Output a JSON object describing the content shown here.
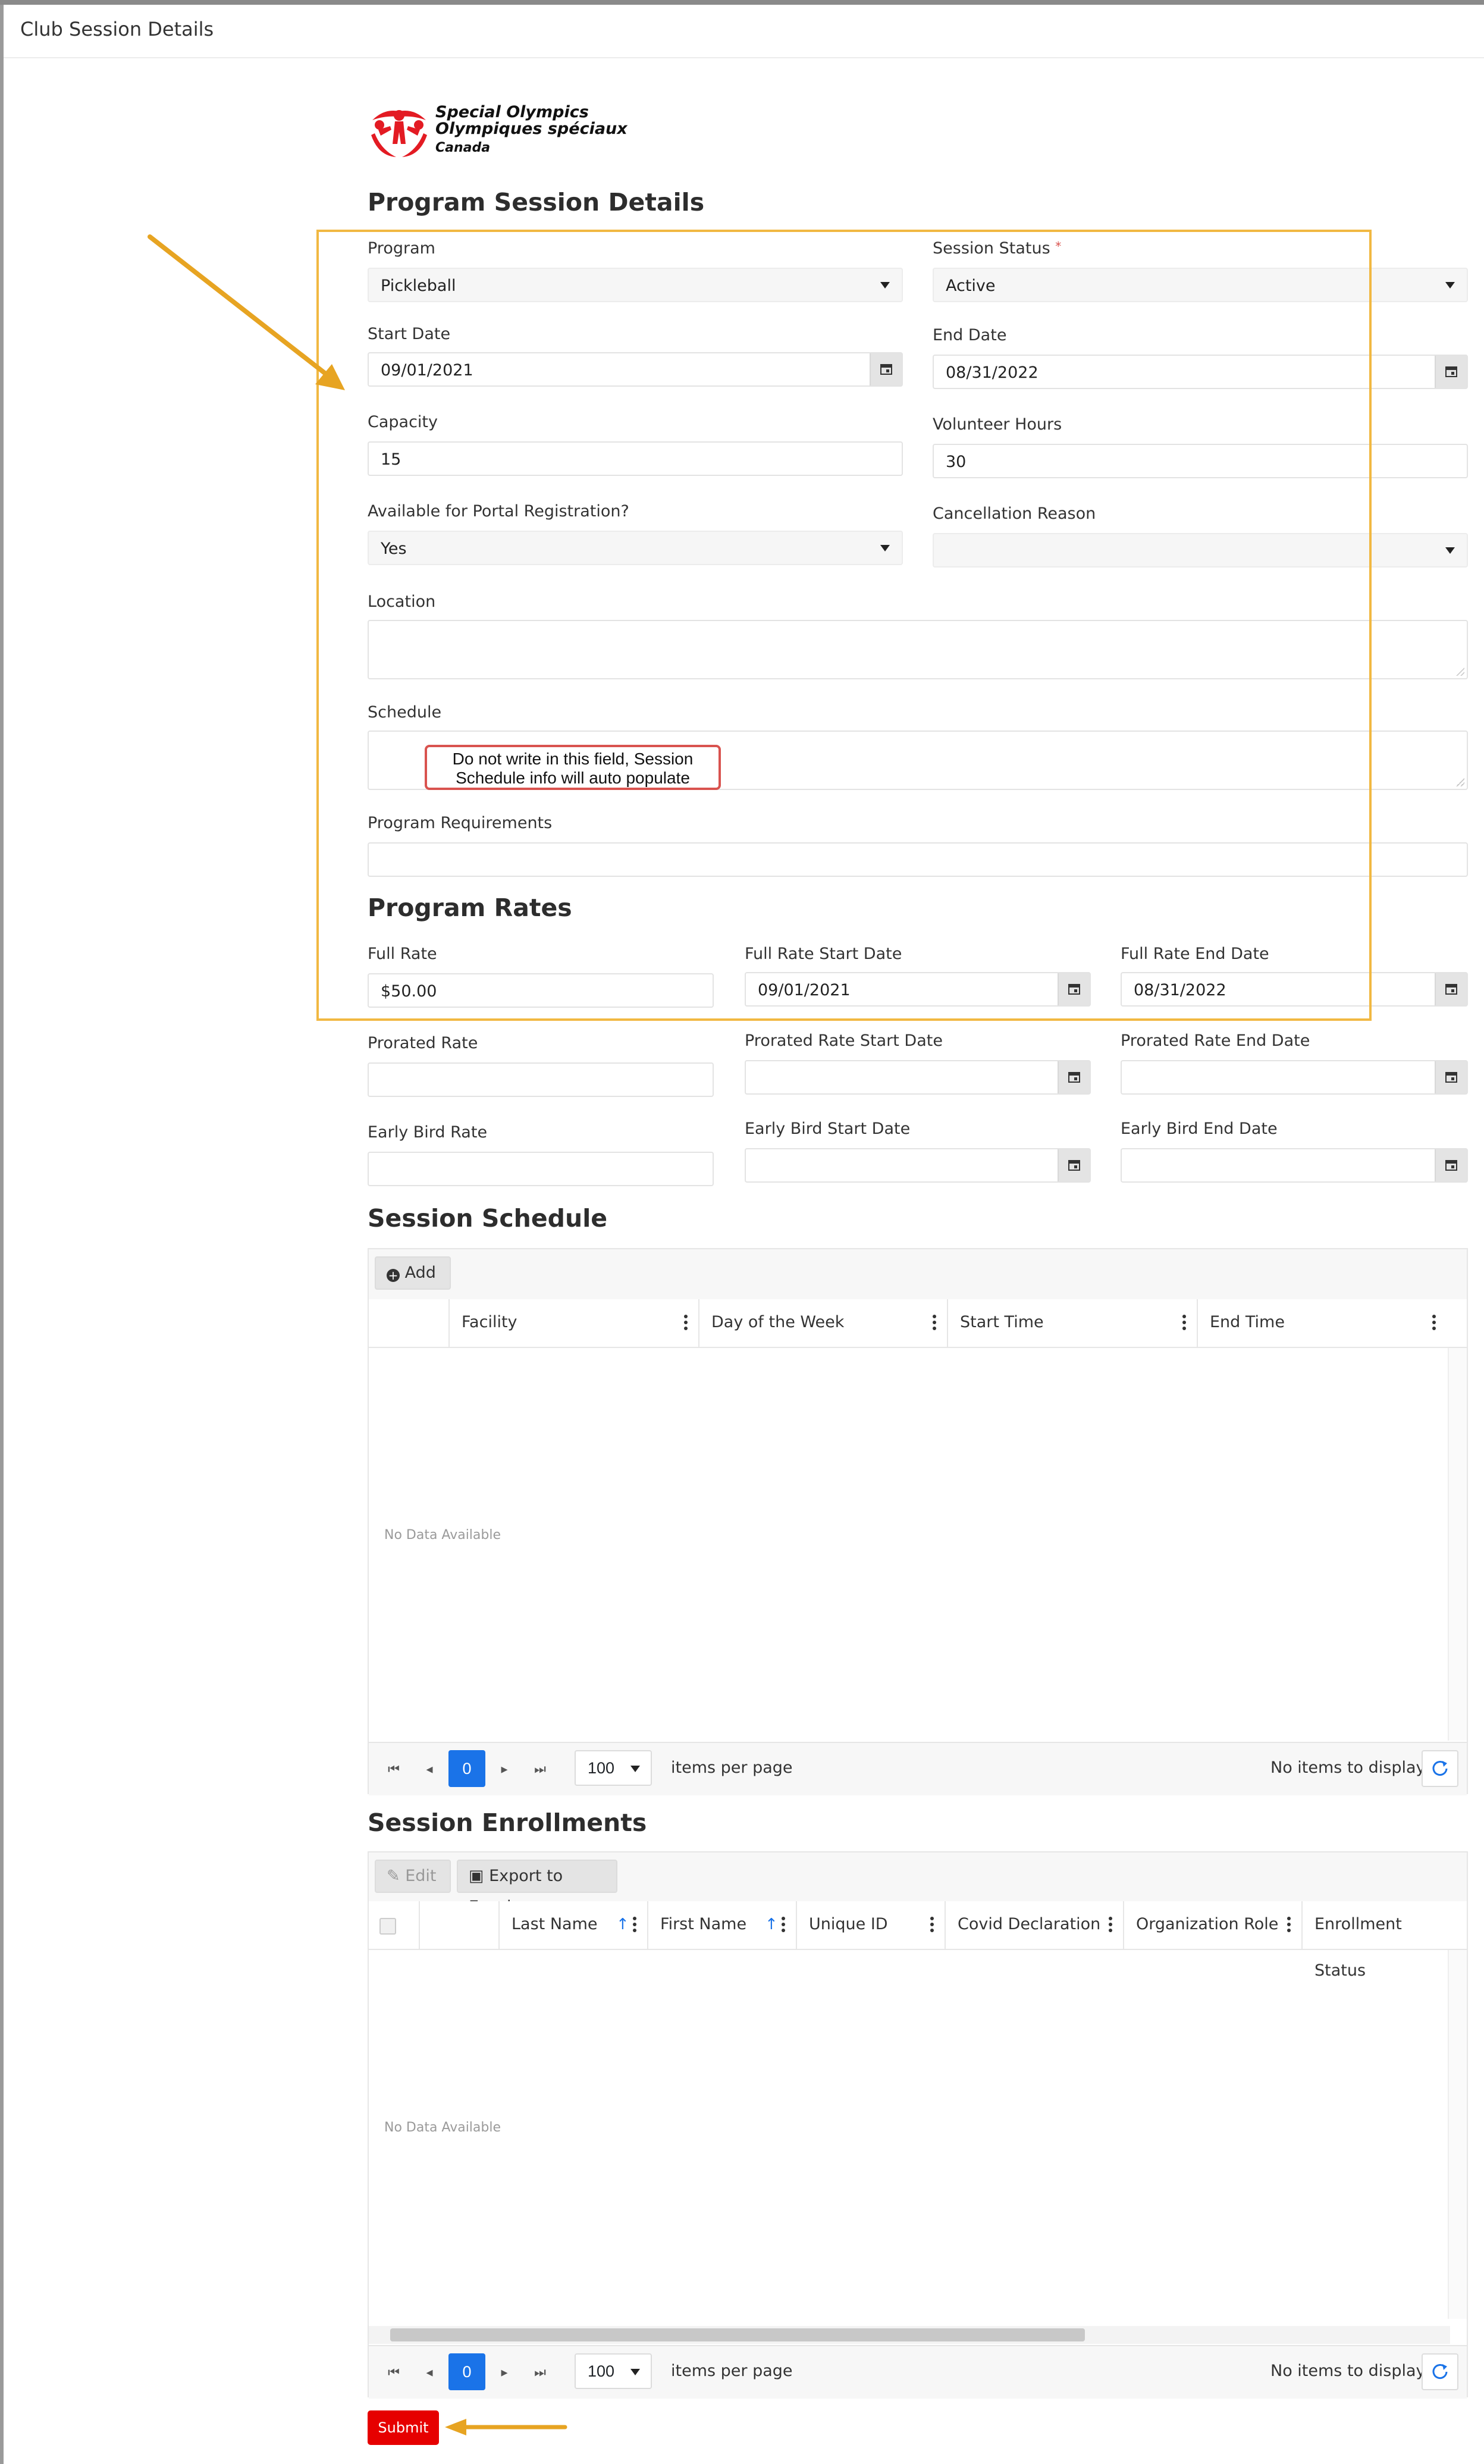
{
  "window": {
    "title": "Club Session Details"
  },
  "logo": {
    "line1": "Special Olympics",
    "line2": "Olympiques spéciaux",
    "line3": "Canada"
  },
  "colors": {
    "accent": "#1a73e8",
    "highlight": "#f1b842",
    "submit": "#e60000",
    "callout_border": "#d9534f"
  },
  "details": {
    "heading": "Program Session Details",
    "program": {
      "label": "Program",
      "value": "Pickleball"
    },
    "session_status": {
      "label": "Session Status",
      "required_mark": "*",
      "value": "Active"
    },
    "start_date": {
      "label": "Start Date",
      "value": "09/01/2021"
    },
    "end_date": {
      "label": "End Date",
      "value": "08/31/2022"
    },
    "capacity": {
      "label": "Capacity",
      "value": "15"
    },
    "volunteer_hours": {
      "label": "Volunteer Hours",
      "value": "30"
    },
    "portal_registration": {
      "label": "Available for Portal Registration?",
      "value": "Yes"
    },
    "cancellation_reason": {
      "label": "Cancellation Reason",
      "value": ""
    },
    "location": {
      "label": "Location",
      "value": ""
    },
    "schedule": {
      "label": "Schedule",
      "value": ""
    },
    "program_requirements": {
      "label": "Program Requirements",
      "value": ""
    },
    "callout": "Do not write in this field, Session Schedule info will auto populate"
  },
  "rates": {
    "heading": "Program Rates",
    "full_rate": {
      "label": "Full Rate",
      "value": "$50.00"
    },
    "full_rate_start": {
      "label": "Full Rate Start Date",
      "value": "09/01/2021"
    },
    "full_rate_end": {
      "label": "Full Rate End Date",
      "value": "08/31/2022"
    },
    "prorated_rate": {
      "label": "Prorated Rate",
      "value": ""
    },
    "prorated_start": {
      "label": "Prorated Rate Start Date",
      "value": ""
    },
    "prorated_end": {
      "label": "Prorated Rate End Date",
      "value": ""
    },
    "early_bird_rate": {
      "label": "Early Bird Rate",
      "value": ""
    },
    "early_bird_start": {
      "label": "Early Bird Start Date",
      "value": ""
    },
    "early_bird_end": {
      "label": "Early Bird End Date",
      "value": ""
    }
  },
  "schedule_grid": {
    "heading": "Session Schedule",
    "add_label": "Add",
    "columns": [
      "Facility",
      "Day of the Week",
      "Start Time",
      "End Time"
    ],
    "no_data": "No Data Available",
    "pager": {
      "current_page": "0",
      "page_size": "100",
      "items_per_page": "items per page",
      "status": "No items to display"
    }
  },
  "enrollments": {
    "heading": "Session Enrollments",
    "edit_label": "Edit",
    "export_label": "Export to Excel",
    "columns": [
      "Last Name",
      "First Name",
      "Unique ID",
      "Covid Declaration",
      "Organization Role",
      "Enrollment Status"
    ],
    "sort_icons": [
      "↑",
      "↑"
    ],
    "no_data": "No Data Available",
    "pager": {
      "current_page": "0",
      "page_size": "100",
      "items_per_page": "items per page",
      "status": "No items to display"
    }
  },
  "submit_label": "Submit"
}
